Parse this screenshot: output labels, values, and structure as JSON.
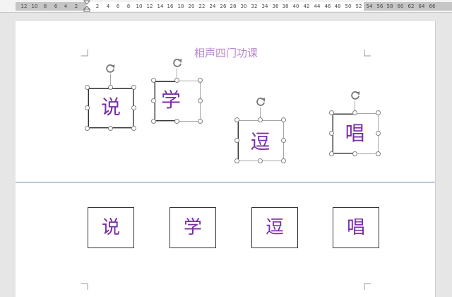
{
  "ruler": {
    "ticks": [
      "12",
      "10",
      "8",
      "6",
      "4",
      "2",
      "2",
      "4",
      "6",
      "8",
      "10",
      "12",
      "14",
      "16",
      "18",
      "20",
      "22",
      "24",
      "26",
      "28",
      "30",
      "32",
      "34",
      "36",
      "38",
      "40",
      "42",
      "44",
      "46",
      "48",
      "50",
      "52",
      "54",
      "56",
      "58",
      "60",
      "62",
      "64",
      "66"
    ]
  },
  "document": {
    "title": "相声四门功课",
    "selected_shapes": [
      {
        "char": "说"
      },
      {
        "char": "学"
      },
      {
        "char": "逗"
      },
      {
        "char": "唱"
      }
    ],
    "boxes": [
      {
        "char": "说"
      },
      {
        "char": "学"
      },
      {
        "char": "逗"
      },
      {
        "char": "唱"
      }
    ]
  },
  "colors": {
    "title": "#b886cf",
    "char": "#7a2fa8",
    "page_break": "#7ba2d6"
  },
  "icons": {
    "rotate": "rotate-handle-icon",
    "indent": "indent-marker-icon"
  }
}
